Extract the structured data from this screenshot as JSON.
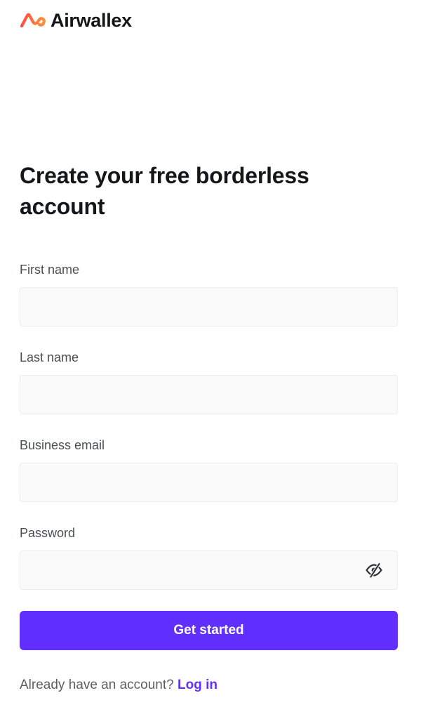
{
  "brand": {
    "name": "Airwallex",
    "logo_icon": "airwallex-logo-icon",
    "logo_colors": [
      "#ff4f42",
      "#ff8e3c"
    ]
  },
  "headline": "Create your free borderless account",
  "form": {
    "fields": [
      {
        "label": "First name",
        "value": "",
        "type": "text"
      },
      {
        "label": "Last name",
        "value": "",
        "type": "text"
      },
      {
        "label": "Business email",
        "value": "",
        "type": "email"
      },
      {
        "label": "Password",
        "value": "",
        "type": "password",
        "toggle_icon": "eye-slash-icon"
      }
    ],
    "submit_label": "Get started"
  },
  "footer": {
    "prompt": "Already have an account?",
    "link_label": "Log in"
  },
  "colors": {
    "accent": "#612fff",
    "text": "#14171a",
    "label": "#4a4f56",
    "input_bg": "#fafafa",
    "input_border": "#ebecee"
  }
}
